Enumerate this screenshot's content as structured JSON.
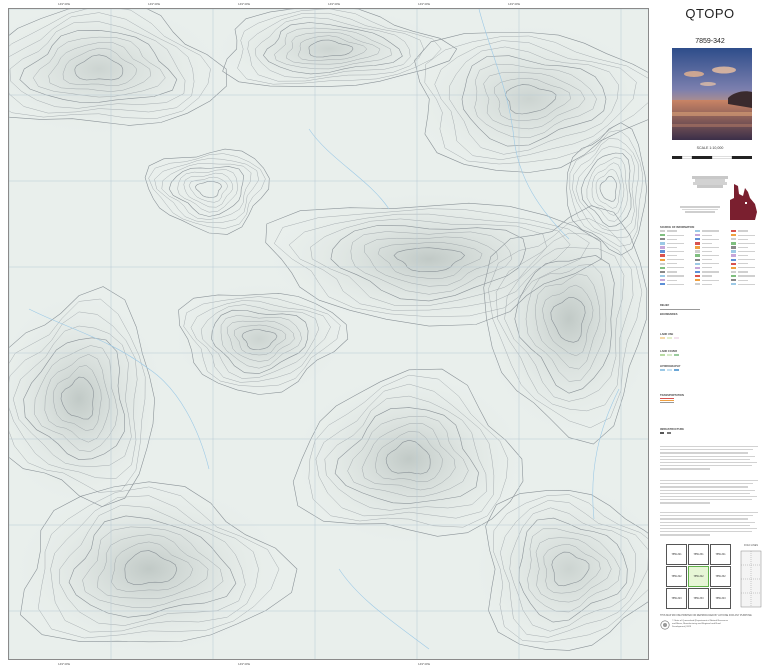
{
  "title": "QTOPO",
  "sheet_number": "7859-342",
  "scale_text": "SCALE 1:10,000",
  "colors": {
    "map_background": "#e9efec",
    "contour": "#8c9499",
    "grid_line": "#b7c9d3",
    "water": "#9cc9e6",
    "title_text": "#222222",
    "index_current": "#e7f6d6",
    "queensland_fill": "#7a1f2f"
  },
  "icons": [
    "photo-image",
    "queensland-locator-map",
    "fold-diagram-icon"
  ],
  "legend_sections": [
    "SOURCE OF INFORMATION",
    "RELIEF",
    "BOUNDARIES",
    "LAND USE",
    "LAND COVER",
    "HYDROGRAPHY",
    "TRANSPORTATION",
    "INFRASTRUCTURE"
  ],
  "index_map": {
    "current": "7859-342",
    "cells": [
      "7859-321",
      "7859-331",
      "7859-341",
      "7859-322",
      "7859-342",
      "7859-332",
      "7859-323",
      "7859-333",
      "7859-343"
    ]
  },
  "fold_label": "FOLD LINES",
  "footer_notice": "THIS MAP MAY BE PRINTED OR REPRODUCED BY ANYONE FOR ANY PURPOSE",
  "copyright": "© State of Queensland (Department of Natural Resources and Mines, Manufacturing and Regional and Rural Development) 2023"
}
